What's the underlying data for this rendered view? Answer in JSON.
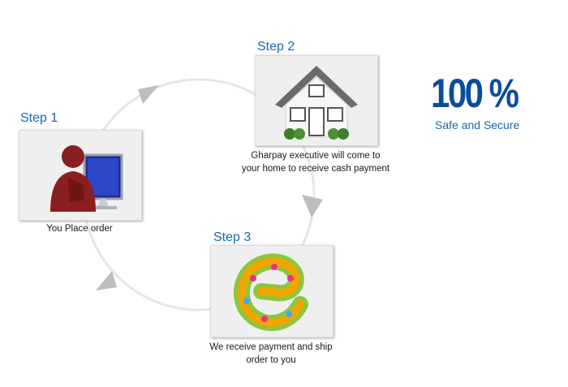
{
  "steps": [
    {
      "title": "Step 1",
      "image": "person-at-computer-icon",
      "caption_lines": [
        "You Place order"
      ]
    },
    {
      "title": "Step 2",
      "image": "house-icon",
      "caption_lines": [
        "Gharpay executive will come to",
        "your home to receive cash payment"
      ]
    },
    {
      "title": "Step 3",
      "image": "floral-e-logo",
      "caption_lines": [
        "We receive payment and ship",
        "order to you"
      ]
    }
  ],
  "badge": {
    "value": "100 %",
    "label": "Safe and Secure"
  },
  "colors": {
    "step_title": "#1a66b3",
    "badge": "#0b4d9a",
    "cycle_arrow": "#e6e6e6",
    "arrowhead": "#bdbdbd",
    "card_background": "#efefef"
  }
}
